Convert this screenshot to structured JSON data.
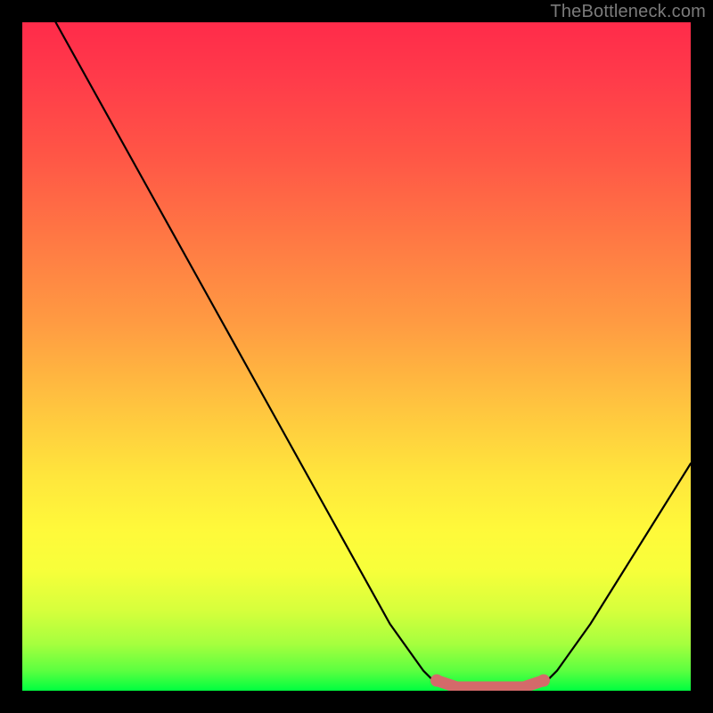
{
  "attribution": "TheBottleneck.com",
  "chart_data": {
    "type": "line",
    "title": "",
    "xlabel": "",
    "ylabel": "",
    "xlim": [
      0,
      100
    ],
    "ylim": [
      0,
      100
    ],
    "series": [
      {
        "name": "bottleneck-curve",
        "x": [
          5,
          10,
          15,
          20,
          25,
          30,
          35,
          40,
          45,
          50,
          55,
          60,
          62,
          65,
          68,
          72,
          75,
          78,
          80,
          85,
          90,
          95,
          100
        ],
        "values": [
          100,
          91,
          82,
          73,
          64,
          55,
          46,
          37,
          28,
          19,
          10,
          3,
          1,
          0,
          0,
          0,
          0,
          1,
          3,
          10,
          18,
          26,
          34
        ]
      }
    ],
    "highlight": {
      "name": "optimal-band",
      "x_center": 70,
      "x_start": 62,
      "x_end": 78,
      "y": 0,
      "color": "#d46a6a"
    },
    "colors": {
      "curve": "#000000",
      "highlight": "#d46a6a",
      "gradient_top": "#ff2b4a",
      "gradient_bottom": "#00ff40"
    }
  }
}
